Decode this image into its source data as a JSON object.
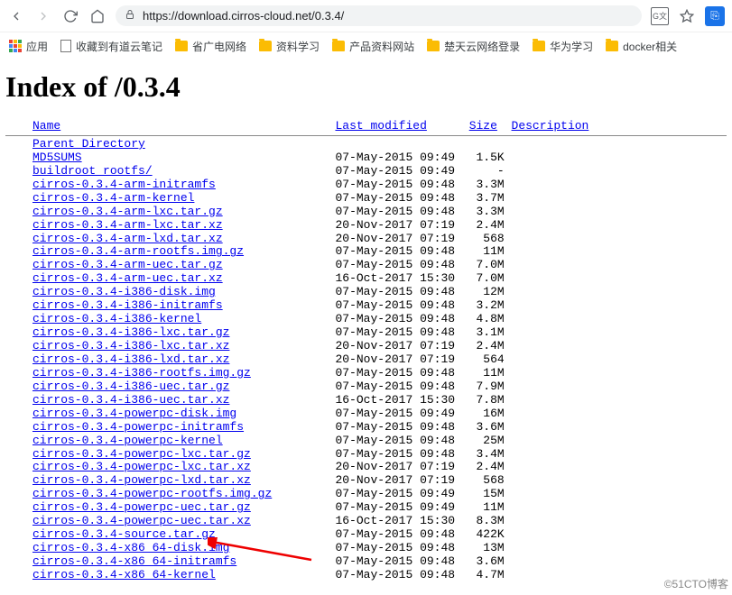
{
  "browser": {
    "url_display": "https://download.cirros-cloud.net/0.3.4/"
  },
  "bookmarks": {
    "apps": "应用",
    "items": [
      {
        "label": "收藏到有道云笔记",
        "icon": "page"
      },
      {
        "label": "省广电网络",
        "icon": "folder"
      },
      {
        "label": "资料学习",
        "icon": "folder"
      },
      {
        "label": "产品资料网站",
        "icon": "folder"
      },
      {
        "label": "楚天云网络登录",
        "icon": "folder"
      },
      {
        "label": "华为学习",
        "icon": "folder"
      },
      {
        "label": "docker相关",
        "icon": "folder"
      }
    ]
  },
  "page": {
    "title": "Index of /0.3.4",
    "headers": {
      "name": "Name",
      "modified": "Last modified",
      "size": "Size",
      "desc": "Description"
    },
    "parent": "Parent Directory",
    "files": [
      {
        "name": "MD5SUMS",
        "date": "07-May-2015 09:49",
        "size": "1.5K"
      },
      {
        "name": "buildroot rootfs/",
        "date": "07-May-2015 09:49",
        "size": "-"
      },
      {
        "name": "cirros-0.3.4-arm-initramfs",
        "date": "07-May-2015 09:48",
        "size": "3.3M"
      },
      {
        "name": "cirros-0.3.4-arm-kernel",
        "date": "07-May-2015 09:48",
        "size": "3.7M"
      },
      {
        "name": "cirros-0.3.4-arm-lxc.tar.gz",
        "date": "07-May-2015 09:48",
        "size": "3.3M"
      },
      {
        "name": "cirros-0.3.4-arm-lxc.tar.xz",
        "date": "20-Nov-2017 07:19",
        "size": "2.4M"
      },
      {
        "name": "cirros-0.3.4-arm-lxd.tar.xz",
        "date": "20-Nov-2017 07:19",
        "size": "568"
      },
      {
        "name": "cirros-0.3.4-arm-rootfs.img.gz",
        "date": "07-May-2015 09:48",
        "size": "11M"
      },
      {
        "name": "cirros-0.3.4-arm-uec.tar.gz",
        "date": "07-May-2015 09:48",
        "size": "7.0M"
      },
      {
        "name": "cirros-0.3.4-arm-uec.tar.xz",
        "date": "16-Oct-2017 15:30",
        "size": "7.0M"
      },
      {
        "name": "cirros-0.3.4-i386-disk.img",
        "date": "07-May-2015 09:48",
        "size": "12M"
      },
      {
        "name": "cirros-0.3.4-i386-initramfs",
        "date": "07-May-2015 09:48",
        "size": "3.2M"
      },
      {
        "name": "cirros-0.3.4-i386-kernel",
        "date": "07-May-2015 09:48",
        "size": "4.8M"
      },
      {
        "name": "cirros-0.3.4-i386-lxc.tar.gz",
        "date": "07-May-2015 09:48",
        "size": "3.1M"
      },
      {
        "name": "cirros-0.3.4-i386-lxc.tar.xz",
        "date": "20-Nov-2017 07:19",
        "size": "2.4M"
      },
      {
        "name": "cirros-0.3.4-i386-lxd.tar.xz",
        "date": "20-Nov-2017 07:19",
        "size": "564"
      },
      {
        "name": "cirros-0.3.4-i386-rootfs.img.gz",
        "date": "07-May-2015 09:48",
        "size": "11M"
      },
      {
        "name": "cirros-0.3.4-i386-uec.tar.gz",
        "date": "07-May-2015 09:48",
        "size": "7.9M"
      },
      {
        "name": "cirros-0.3.4-i386-uec.tar.xz",
        "date": "16-Oct-2017 15:30",
        "size": "7.8M"
      },
      {
        "name": "cirros-0.3.4-powerpc-disk.img",
        "date": "07-May-2015 09:49",
        "size": "16M"
      },
      {
        "name": "cirros-0.3.4-powerpc-initramfs",
        "date": "07-May-2015 09:48",
        "size": "3.6M"
      },
      {
        "name": "cirros-0.3.4-powerpc-kernel",
        "date": "07-May-2015 09:48",
        "size": "25M"
      },
      {
        "name": "cirros-0.3.4-powerpc-lxc.tar.gz",
        "date": "07-May-2015 09:48",
        "size": "3.4M"
      },
      {
        "name": "cirros-0.3.4-powerpc-lxc.tar.xz",
        "date": "20-Nov-2017 07:19",
        "size": "2.4M"
      },
      {
        "name": "cirros-0.3.4-powerpc-lxd.tar.xz",
        "date": "20-Nov-2017 07:19",
        "size": "568"
      },
      {
        "name": "cirros-0.3.4-powerpc-rootfs.img.gz",
        "date": "07-May-2015 09:49",
        "size": "15M"
      },
      {
        "name": "cirros-0.3.4-powerpc-uec.tar.gz",
        "date": "07-May-2015 09:49",
        "size": "11M"
      },
      {
        "name": "cirros-0.3.4-powerpc-uec.tar.xz",
        "date": "16-Oct-2017 15:30",
        "size": "8.3M"
      },
      {
        "name": "cirros-0.3.4-source.tar.gz",
        "date": "07-May-2015 09:48",
        "size": "422K"
      },
      {
        "name": "cirros-0.3.4-x86 64-disk.img",
        "date": "07-May-2015 09:48",
        "size": "13M"
      },
      {
        "name": "cirros-0.3.4-x86 64-initramfs",
        "date": "07-May-2015 09:48",
        "size": "3.6M"
      },
      {
        "name": "cirros-0.3.4-x86 64-kernel",
        "date": "07-May-2015 09:48",
        "size": "4.7M"
      }
    ]
  },
  "watermark": "©51CTO博客"
}
